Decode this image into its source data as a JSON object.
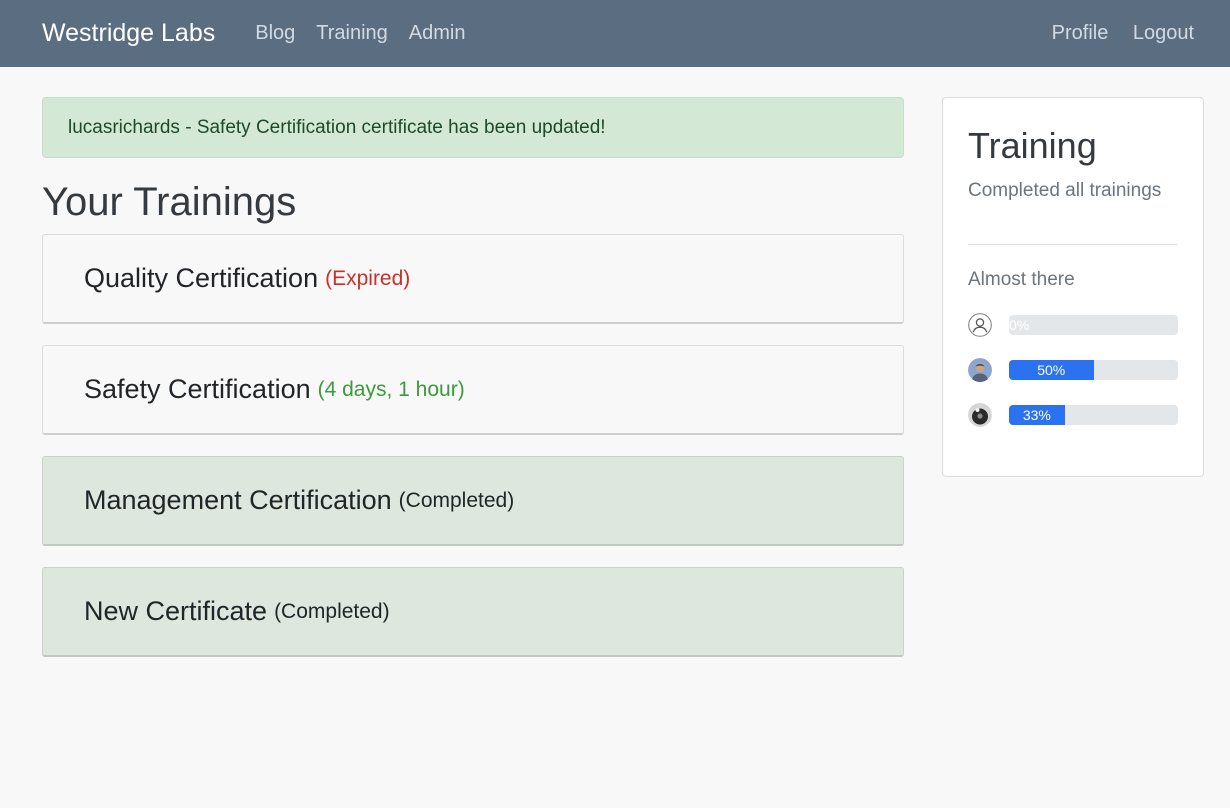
{
  "nav": {
    "brand": "Westridge Labs",
    "links": [
      "Blog",
      "Training",
      "Admin"
    ],
    "right_links": [
      "Profile",
      "Logout"
    ]
  },
  "alert": {
    "message": "lucasrichards - Safety Certification certificate has been updated!"
  },
  "main": {
    "title": "Your Trainings",
    "trainings": [
      {
        "name": "Quality Certification",
        "status": "(Expired)"
      },
      {
        "name": "Safety Certification",
        "status": "(4 days, 1 hour)"
      },
      {
        "name": "Management Certification",
        "status": "(Completed)"
      },
      {
        "name": "New Certificate",
        "status": "(Completed)"
      }
    ]
  },
  "sidebar": {
    "title": "Training",
    "subtitle": "Completed all trainings",
    "section": "Almost there",
    "progress": [
      {
        "label": "0%",
        "value": 0,
        "avatar": "default-user-icon"
      },
      {
        "label": "50%",
        "value": 50,
        "avatar": "user-photo"
      },
      {
        "label": "33%",
        "value": 33,
        "avatar": "user-photo"
      }
    ]
  },
  "colors": {
    "navbar": "#5b6d80",
    "alert_bg": "#d3e9d6",
    "expired": "#c9302c",
    "active": "#3c9a3c",
    "progress": "#2b72f0",
    "completed_card": "#dde7dd"
  }
}
